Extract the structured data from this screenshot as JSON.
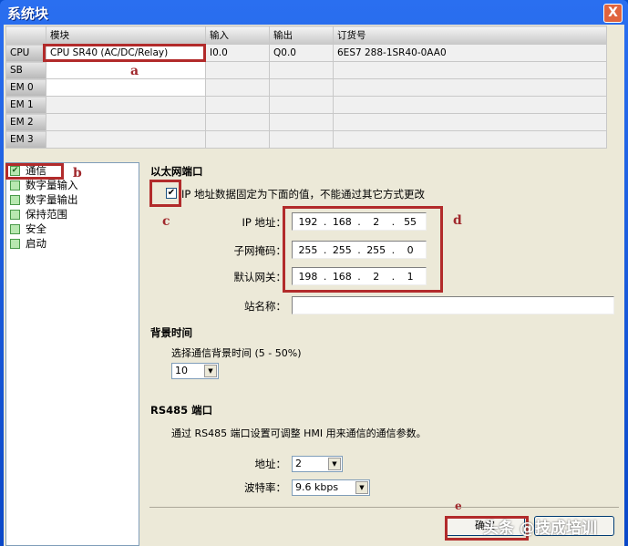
{
  "window": {
    "title": "系统块",
    "close": "X"
  },
  "grid": {
    "headers": [
      "模块",
      "输入",
      "输出",
      "订货号"
    ],
    "rows": [
      {
        "slot": "CPU",
        "module": "CPU SR40 (AC/DC/Relay)",
        "input": "I0.0",
        "output": "Q0.0",
        "order": "6ES7 288-1SR40-0AA0"
      },
      {
        "slot": "SB",
        "module": "",
        "input": "",
        "output": "",
        "order": ""
      },
      {
        "slot": "EM 0",
        "module": "",
        "input": "",
        "output": "",
        "order": ""
      },
      {
        "slot": "EM 1",
        "module": "",
        "input": "",
        "output": "",
        "order": ""
      },
      {
        "slot": "EM 2",
        "module": "",
        "input": "",
        "output": "",
        "order": ""
      },
      {
        "slot": "EM 3",
        "module": "",
        "input": "",
        "output": "",
        "order": ""
      }
    ]
  },
  "tree": [
    "通信",
    "数字量输入",
    "数字量输出",
    "保持范围",
    "安全",
    "启动"
  ],
  "ethernet": {
    "title": "以太网端口",
    "fixed_ip_label": "IP 地址数据固定为下面的值，不能通过其它方式更改",
    "fixed_ip_checked": true,
    "ip_label": "IP 地址：",
    "ip": [
      "192",
      "168",
      "2",
      "55"
    ],
    "mask_label": "子网掩码：",
    "mask": [
      "255",
      "255",
      "255",
      "0"
    ],
    "gw_label": "默认网关：",
    "gw": [
      "198",
      "168",
      "2",
      "1"
    ],
    "station_label": "站名称：",
    "station": ""
  },
  "background": {
    "title": "背景时间",
    "label": "选择通信背景时间 (5 - 50%)",
    "value": "10"
  },
  "rs485": {
    "title": "RS485 端口",
    "desc": "通过 RS485 端口设置可调整 HMI 用来通信的通信参数。",
    "addr_label": "地址：",
    "addr": "2",
    "baud_label": "波特率：",
    "baud": "9.6 kbps"
  },
  "buttons": {
    "ok": "确定"
  },
  "annotations": [
    "a",
    "b",
    "c",
    "d",
    "e"
  ],
  "watermark": "头条 @技成培训"
}
